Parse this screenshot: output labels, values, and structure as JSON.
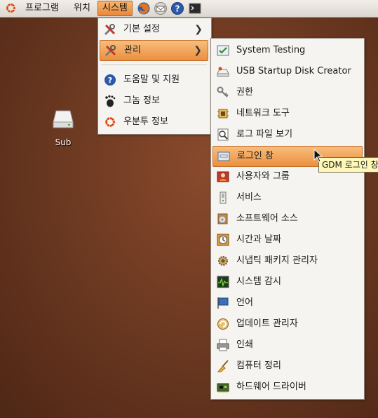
{
  "panel": {
    "menus": [
      "프로그램",
      "위치",
      "시스템"
    ],
    "launchers": [
      "firefox-icon",
      "mail-icon",
      "help-icon",
      "terminal-icon"
    ]
  },
  "desktop": {
    "icons": [
      {
        "label": "Sub",
        "icon": "drive-icon"
      }
    ]
  },
  "system_menu": {
    "items": [
      {
        "label": "기본 설정",
        "icon": "tools-icon",
        "submenu": true
      },
      {
        "label": "관리",
        "icon": "tools-icon",
        "submenu": true,
        "highlighted": true
      },
      {
        "label": "도움말 및 지원",
        "icon": "help-icon"
      },
      {
        "label": "그놈 정보",
        "icon": "gnome-foot-icon"
      },
      {
        "label": "우분투 정보",
        "icon": "ubuntu-icon"
      }
    ]
  },
  "admin_menu": {
    "items": [
      {
        "label": "System Testing",
        "icon": "checklist-icon"
      },
      {
        "label": "USB Startup Disk Creator",
        "icon": "usb-drive-icon"
      },
      {
        "label": "권한",
        "icon": "keys-icon"
      },
      {
        "label": "네트워크 도구",
        "icon": "network-icon"
      },
      {
        "label": "로그 파일 보기",
        "icon": "log-viewer-icon"
      },
      {
        "label": "로그인 창",
        "icon": "login-window-icon",
        "highlighted": true
      },
      {
        "label": "사용자와 그룹",
        "icon": "users-icon"
      },
      {
        "label": "서비스",
        "icon": "server-icon"
      },
      {
        "label": "소프트웨어 소스",
        "icon": "software-sources-icon"
      },
      {
        "label": "시간과 날짜",
        "icon": "clock-icon"
      },
      {
        "label": "시냅틱 패키지 관리자",
        "icon": "synaptic-icon"
      },
      {
        "label": "시스템 감시",
        "icon": "monitor-icon"
      },
      {
        "label": "언어",
        "icon": "flag-icon"
      },
      {
        "label": "업데이트 관리자",
        "icon": "update-icon"
      },
      {
        "label": "인쇄",
        "icon": "printer-icon"
      },
      {
        "label": "컴퓨터 정리",
        "icon": "broom-icon"
      },
      {
        "label": "하드웨어 드라이버",
        "icon": "hardware-icon"
      }
    ]
  },
  "tooltip": {
    "text": "GDM 로그인 창"
  },
  "colors": {
    "highlight": "#eb8f3f",
    "menu_bg": "#f6f4f1",
    "tooltip_bg": "#fdf7b8"
  }
}
